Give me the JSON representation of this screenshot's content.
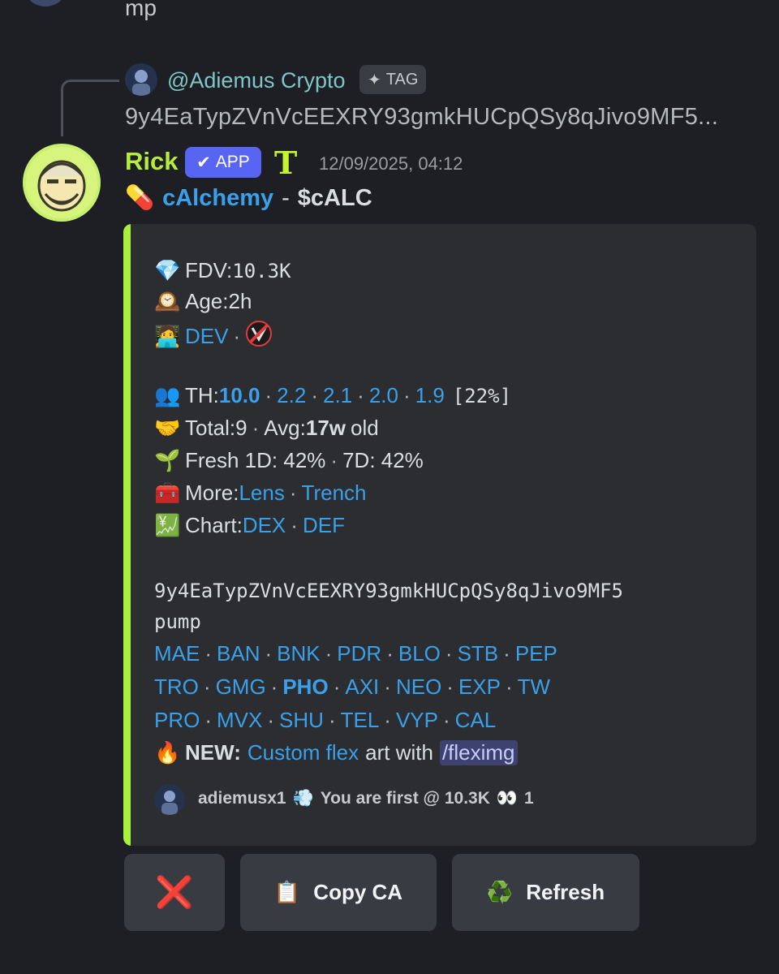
{
  "top": {
    "text": "mp"
  },
  "reply": {
    "name": "@Adiemus Crypto",
    "tag_label": "TAG",
    "ca": "9y4EaTypZVnVcEEXRY93gmkHUCpQSy8qJivo9MF5..."
  },
  "message": {
    "author": "Rick",
    "app_label": "APP",
    "t_glyph": "T",
    "timestamp": "12/09/2025, 04:12",
    "token_emoji": "💊",
    "token_name": "cAlchemy",
    "token_sep": "-",
    "ticker": "$cALC"
  },
  "embed": {
    "accent": "#a8f03a",
    "fdv": {
      "emoji": "💎",
      "label": "FDV: ",
      "value": "10.3K"
    },
    "age": {
      "emoji": "🕰️",
      "label": "Age: ",
      "value": "2h"
    },
    "dev": {
      "emoji": "🧑‍💻",
      "link": "DEV",
      "sep": "·",
      "icon": "no-entry-icon"
    },
    "th": {
      "emoji": "👥",
      "label": "TH: ",
      "values": [
        "10.0",
        "2.2",
        "2.1",
        "2.0",
        "1.9"
      ],
      "pct": "[22%]"
    },
    "total": {
      "emoji": "🤝",
      "label": "Total: ",
      "value": "9",
      "avg_label": "Avg: ",
      "avg_value": "17w",
      "avg_suffix": "old"
    },
    "fresh": {
      "emoji": "🌱",
      "text1": "Fresh 1D: 42%",
      "text2": "7D: 42%"
    },
    "more": {
      "emoji": "🧰",
      "label": "More: ",
      "link1": "Lens",
      "link2": "Trench"
    },
    "chart": {
      "emoji": "💹",
      "label": "Chart: ",
      "link1": "DEX",
      "link2": "DEF"
    },
    "ca_line1": "9y4EaTypZVnVcEEXRY93gmkHUCpQSy8qJivo9MF5",
    "ca_line2": "pump",
    "platforms_row1": [
      "MAE",
      "BAN",
      "BNK",
      "PDR",
      "BLO",
      "STB",
      "PEP"
    ],
    "platforms_row2": [
      "TRO",
      "GMG",
      "PHO",
      "AXI",
      "NEO",
      "EXP",
      "TW"
    ],
    "platforms_row3": [
      "PRO",
      "MVX",
      "SHU",
      "TEL",
      "VYP",
      "CAL"
    ],
    "new": {
      "emoji": "🔥",
      "label": "NEW:",
      "link": "Custom flex",
      "middle": "art with",
      "command": "/fleximg"
    },
    "footer": {
      "user": "adiemusx1",
      "emoji": "💨",
      "text": "You are first @ 10.3K",
      "eyes": "👀",
      "count": "1"
    }
  },
  "buttons": {
    "close_icon": "❌",
    "copy_emoji": "📋",
    "copy_label": "Copy CA",
    "refresh_emoji": "♻️",
    "refresh_label": "Refresh"
  }
}
